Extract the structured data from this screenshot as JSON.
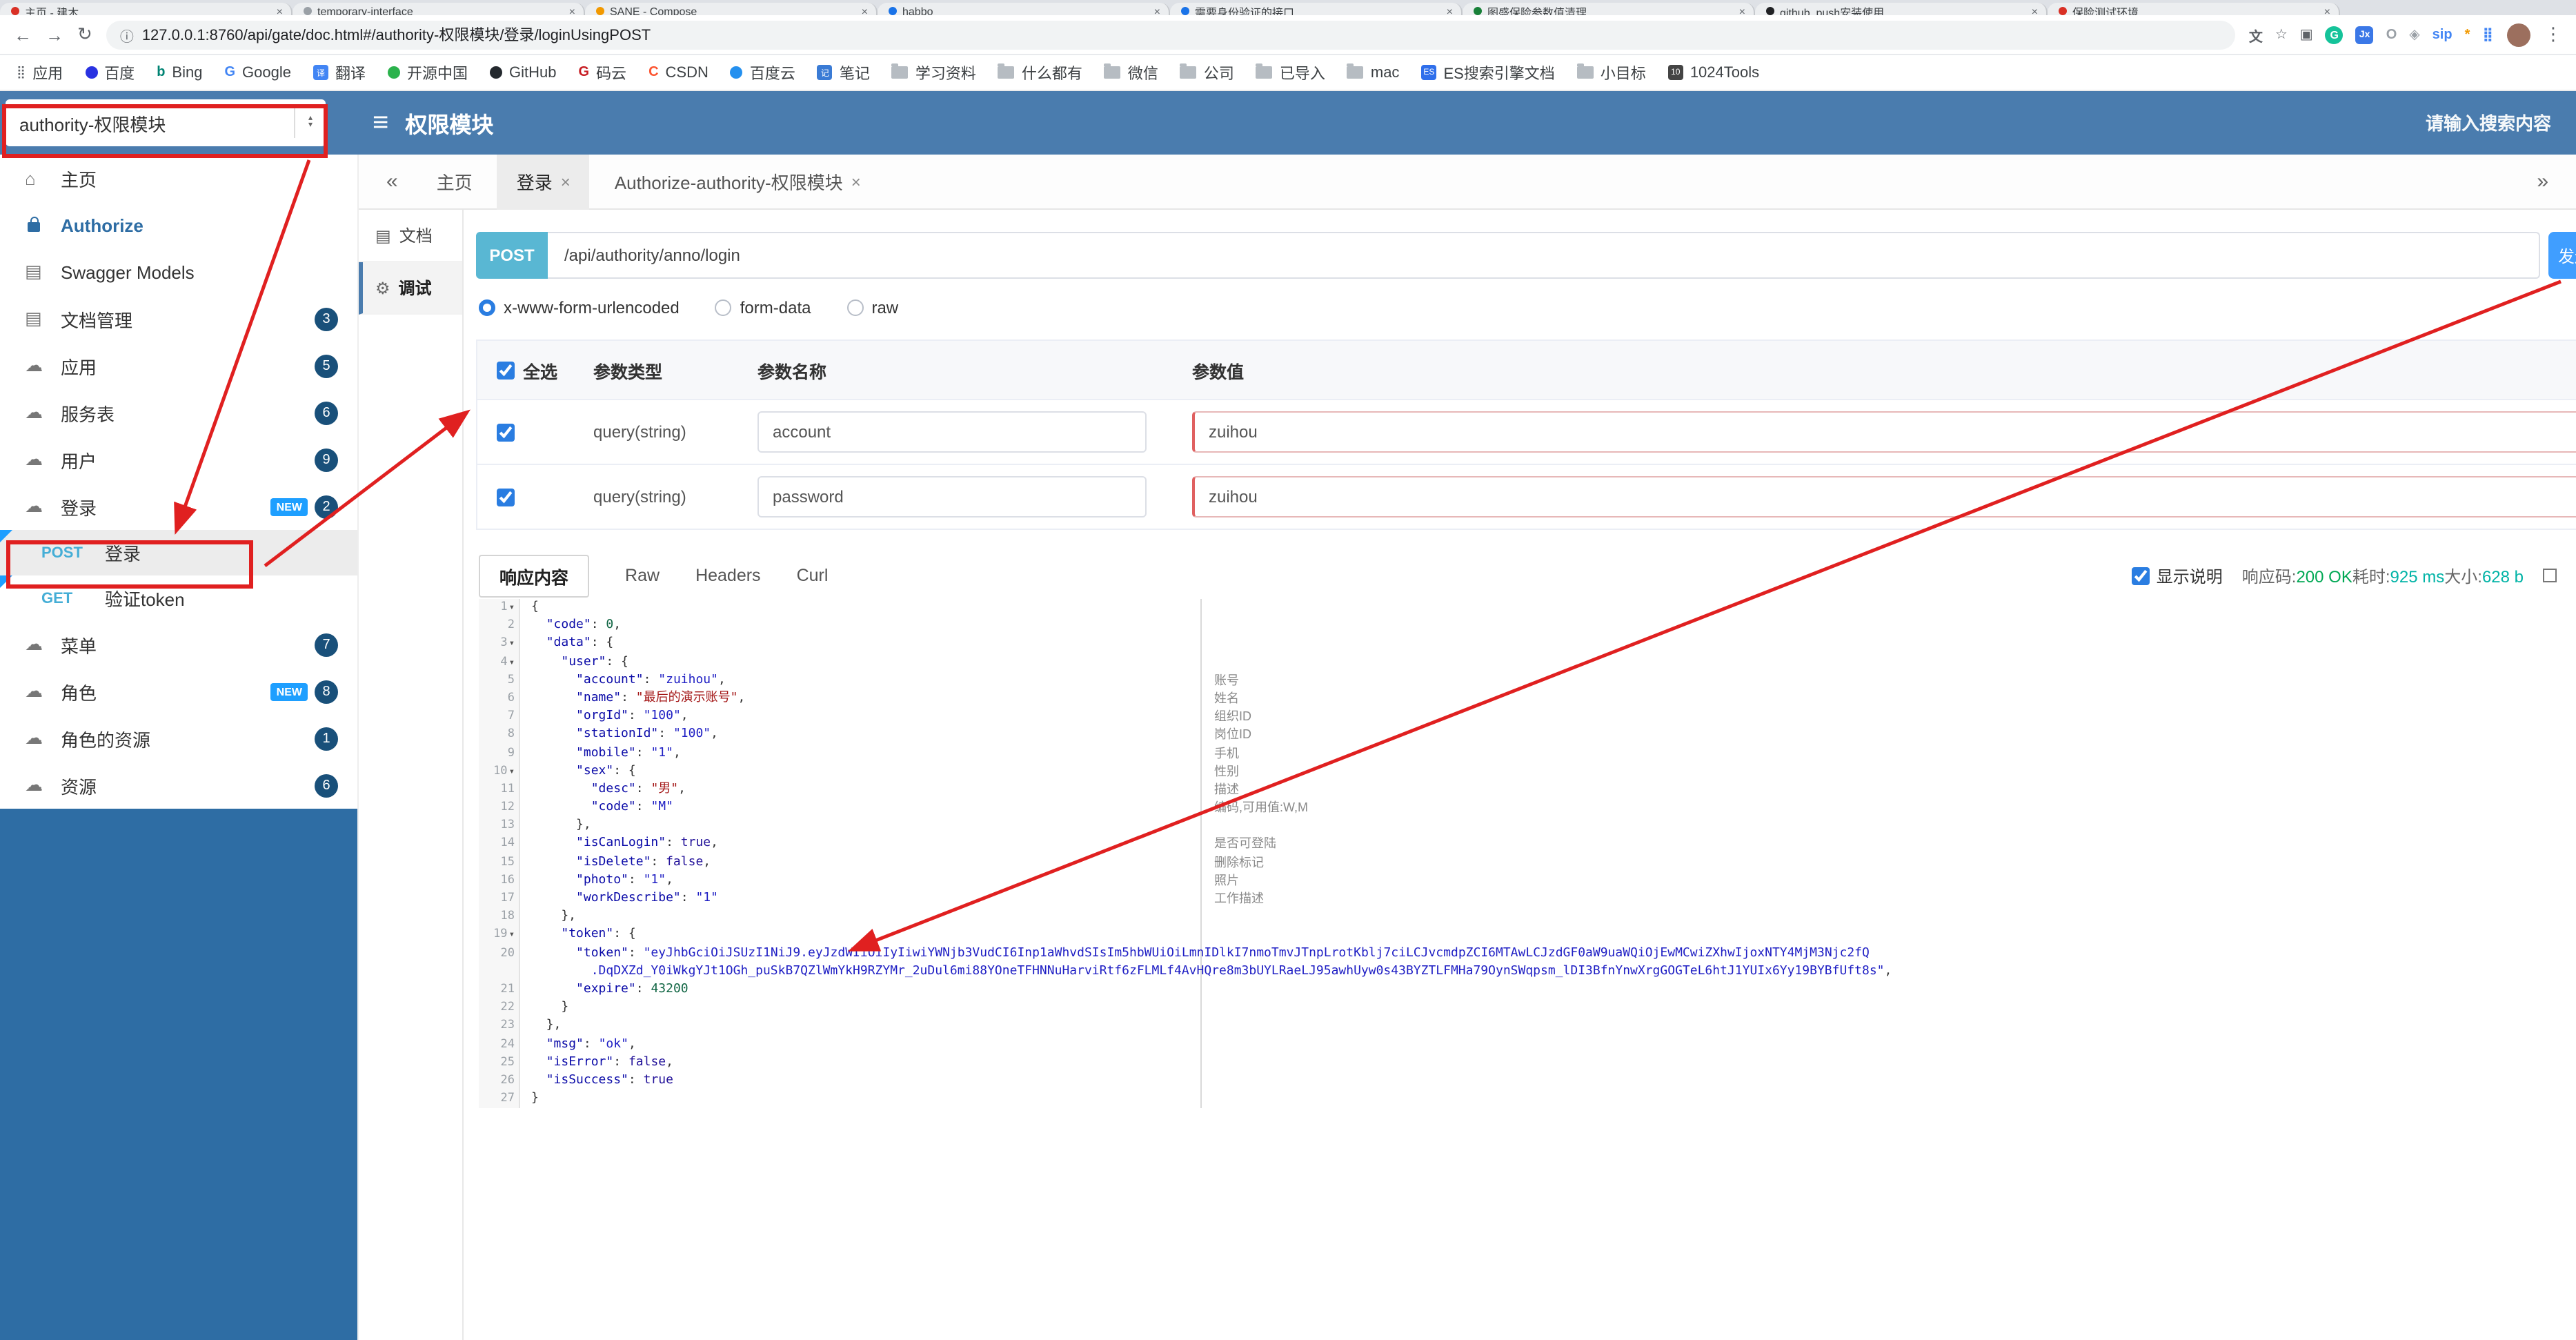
{
  "colors": {
    "header_blue": "#4a7cae",
    "sidebar_blue": "#2e6da4",
    "accent_blue": "#409eff",
    "post_badge_blue": "#59b7d3",
    "badge_navy": "#19507a",
    "new_badge_blue": "#1e9fff",
    "annotation_red": "#e02020",
    "success_green": "#00a854",
    "teal": "#00b3a6"
  },
  "icons": {
    "hamburger": "≡",
    "home": "⌂",
    "models": "▤",
    "docfolder": "▤",
    "cloud": "☁",
    "doc": "▤",
    "debug": "⚙",
    "collapse": "«",
    "expand": "»",
    "back": "←",
    "forward": "→",
    "reload": "↻",
    "info": "ⓘ",
    "more": "⋮",
    "sort_up": "▴",
    "sort_down": "▾",
    "close": "×",
    "grid": "⣿"
  },
  "browser": {
    "close_glyph": "×",
    "url": "127.0.0.1:8760/api/gate/doc.html#/authority-权限模块/登录/loginUsingPOST",
    "tabs": [
      {
        "label": "主页 - 建木",
        "color": "#d93025"
      },
      {
        "label": "temporary-interface",
        "color": "#9aa0a6"
      },
      {
        "label": "SANE - Compose",
        "color": "#f29900"
      },
      {
        "label": "habbo",
        "color": "#1a73e8"
      },
      {
        "label": "需要身份验证的接口",
        "color": "#1a73e8"
      },
      {
        "label": "图盛保险参数值清理",
        "color": "#188038"
      },
      {
        "label": "github_push安装使用",
        "color": "#202124"
      },
      {
        "label": "保险测试环境",
        "color": "#d93025"
      }
    ],
    "bookmarks": [
      {
        "label": "应用",
        "icon": "grid"
      },
      {
        "label": "百度",
        "icon": "dot",
        "color": "#2932e1"
      },
      {
        "label": "Bing",
        "icon": "letter",
        "glyph": "b",
        "color": "#008373"
      },
      {
        "label": "Google",
        "icon": "letter",
        "glyph": "G",
        "color": "#4285f4"
      },
      {
        "label": "翻译",
        "icon": "square",
        "glyph": "译",
        "color": "#4285f4"
      },
      {
        "label": "开源中国",
        "icon": "dot",
        "color": "#2bb24c"
      },
      {
        "label": "GitHub",
        "icon": "dot",
        "color": "#24292e"
      },
      {
        "label": "码云",
        "icon": "letter",
        "glyph": "G",
        "color": "#c71d23"
      },
      {
        "label": "CSDN",
        "icon": "letter",
        "glyph": "C",
        "color": "#fc5531"
      },
      {
        "label": "百度云",
        "icon": "dot",
        "color": "#2490ef"
      },
      {
        "label": "笔记",
        "icon": "square",
        "glyph": "记",
        "color": "#3a7bd5"
      },
      {
        "label": "学习资料",
        "icon": "folder"
      },
      {
        "label": "什么都有",
        "icon": "folder"
      },
      {
        "label": "微信",
        "icon": "folder"
      },
      {
        "label": "公司",
        "icon": "folder"
      },
      {
        "label": "已导入",
        "icon": "folder"
      },
      {
        "label": "mac",
        "icon": "folder"
      },
      {
        "label": "ES搜索引擎文档",
        "icon": "square",
        "glyph": "ES",
        "color": "#2f6feb"
      },
      {
        "label": "小目标",
        "icon": "folder"
      },
      {
        "label": "1024Tools",
        "icon": "square",
        "glyph": "10",
        "color": "#444444"
      }
    ],
    "ext_icons": [
      {
        "name": "translate-icon",
        "glyph": "文",
        "color": "#5f6368",
        "shape": "plain"
      },
      {
        "name": "bookmark-star-icon",
        "glyph": "☆",
        "color": "#5f6368",
        "shape": "plain"
      },
      {
        "name": "screenshot-ext-icon",
        "glyph": "▣",
        "color": "#5f6368",
        "shape": "plain"
      },
      {
        "name": "grammarly-ext-icon",
        "glyph": "G",
        "color": "#15c39a",
        "shape": "circle"
      },
      {
        "name": "json-ext-icon",
        "glyph": "Jx",
        "color": "#3b78e7",
        "shape": "square"
      },
      {
        "name": "ring-ext-icon",
        "glyph": "O",
        "color": "#9aa0a6",
        "shape": "plain"
      },
      {
        "name": "shield-ext-icon",
        "glyph": "◈",
        "color": "#9aa0a6",
        "shape": "plain"
      },
      {
        "name": "sip-ext-icon",
        "glyph": "sip",
        "color": "#4285f4",
        "shape": "plain"
      },
      {
        "name": "pinwheel-ext-icon",
        "glyph": "*",
        "color": "#f29900",
        "shape": "plain"
      },
      {
        "name": "grid-ext-icon",
        "glyph": "⣿",
        "color": "#4285f4",
        "shape": "plain"
      }
    ]
  },
  "header": {
    "module_select": "authority-权限模块",
    "title": "权限模块",
    "search_placeholder": "请输入搜索内容"
  },
  "sidebar": {
    "new_badge": "NEW",
    "items": [
      {
        "label": "主页"
      },
      {
        "label": "Authorize"
      },
      {
        "label": "Swagger Models"
      },
      {
        "label": "文档管理",
        "badge": "3"
      },
      {
        "label": "应用",
        "badge": "5"
      },
      {
        "label": "服务表",
        "badge": "6"
      },
      {
        "label": "用户",
        "badge": "9"
      },
      {
        "label": "登录",
        "badge": "2",
        "tag": "NEW"
      },
      {
        "label": "菜单",
        "badge": "7"
      },
      {
        "label": "角色",
        "badge": "8",
        "tag": "NEW"
      },
      {
        "label": "角色的资源",
        "badge": "1"
      },
      {
        "label": "资源",
        "badge": "6"
      }
    ],
    "operations": [
      {
        "method": "POST",
        "label": "登录"
      },
      {
        "method": "GET",
        "label": "验证token"
      }
    ]
  },
  "tabsbar": {
    "tabs": [
      {
        "label": "主页"
      },
      {
        "label": "登录"
      },
      {
        "label": "Authorize-authority-权限模块"
      }
    ]
  },
  "docmenu": {
    "doc": "文档",
    "debug": "调试"
  },
  "request": {
    "method": "POST",
    "url": "/api/authority/anno/login",
    "send_label": "发送",
    "content_types": [
      "x-www-form-urlencoded",
      "form-data",
      "raw"
    ],
    "selected_content_type": "x-www-form-urlencoded",
    "table": {
      "select_all": "全选",
      "headers": [
        "参数类型",
        "参数名称",
        "参数值"
      ],
      "rows": [
        {
          "type": "query(string)",
          "name": "account",
          "value": "zuihou"
        },
        {
          "type": "query(string)",
          "name": "password",
          "value": "zuihou"
        }
      ]
    }
  },
  "response": {
    "tabs": [
      "响应内容",
      "Raw",
      "Headers",
      "Curl"
    ],
    "active_tab": "响应内容",
    "show_desc_label": "显示说明",
    "meta": {
      "code_label": "响应码:",
      "code": "200 OK",
      "time_label": "耗时:",
      "time": "925 ms",
      "size_label": "大小:",
      "size": "628 b"
    }
  },
  "code": {
    "rows": [
      {
        "n": "1",
        "fold": true,
        "segs": [
          [
            "p",
            "{"
          ]
        ]
      },
      {
        "n": "2",
        "segs": [
          [
            "p",
            "  "
          ],
          [
            "k",
            "\"code\""
          ],
          [
            "p",
            ": "
          ],
          [
            "num",
            "0"
          ],
          [
            "p",
            ","
          ]
        ]
      },
      {
        "n": "3",
        "fold": true,
        "segs": [
          [
            "p",
            "  "
          ],
          [
            "k",
            "\"data\""
          ],
          [
            "p",
            ": {"
          ]
        ]
      },
      {
        "n": "4",
        "fold": true,
        "segs": [
          [
            "p",
            "    "
          ],
          [
            "k",
            "\"user\""
          ],
          [
            "p",
            ": {"
          ]
        ]
      },
      {
        "n": "5",
        "segs": [
          [
            "p",
            "      "
          ],
          [
            "k",
            "\"account\""
          ],
          [
            "p",
            ": "
          ],
          [
            "s",
            "\"zuihou\""
          ],
          [
            "p",
            ","
          ]
        ],
        "desc": "账号"
      },
      {
        "n": "6",
        "segs": [
          [
            "p",
            "      "
          ],
          [
            "k",
            "\"name\""
          ],
          [
            "p",
            ": "
          ],
          [
            "cn",
            "\"最后的演示账号\""
          ],
          [
            "p",
            ","
          ]
        ],
        "desc": "姓名"
      },
      {
        "n": "7",
        "segs": [
          [
            "p",
            "      "
          ],
          [
            "k",
            "\"orgId\""
          ],
          [
            "p",
            ": "
          ],
          [
            "s",
            "\"100\""
          ],
          [
            "p",
            ","
          ]
        ],
        "desc": "组织ID"
      },
      {
        "n": "8",
        "segs": [
          [
            "p",
            "      "
          ],
          [
            "k",
            "\"stationId\""
          ],
          [
            "p",
            ": "
          ],
          [
            "s",
            "\"100\""
          ],
          [
            "p",
            ","
          ]
        ],
        "desc": "岗位ID"
      },
      {
        "n": "9",
        "segs": [
          [
            "p",
            "      "
          ],
          [
            "k",
            "\"mobile\""
          ],
          [
            "p",
            ": "
          ],
          [
            "s",
            "\"1\""
          ],
          [
            "p",
            ","
          ]
        ],
        "desc": "手机"
      },
      {
        "n": "10",
        "fold": true,
        "segs": [
          [
            "p",
            "      "
          ],
          [
            "k",
            "\"sex\""
          ],
          [
            "p",
            ": {"
          ]
        ],
        "desc": "性别"
      },
      {
        "n": "11",
        "segs": [
          [
            "p",
            "        "
          ],
          [
            "k",
            "\"desc\""
          ],
          [
            "p",
            ": "
          ],
          [
            "cn",
            "\"男\""
          ],
          [
            "p",
            ","
          ]
        ],
        "desc": "描述"
      },
      {
        "n": "12",
        "segs": [
          [
            "p",
            "        "
          ],
          [
            "k",
            "\"code\""
          ],
          [
            "p",
            ": "
          ],
          [
            "s",
            "\"M\""
          ]
        ],
        "desc": "编码,可用值:W,M"
      },
      {
        "n": "13",
        "segs": [
          [
            "p",
            "      },"
          ]
        ]
      },
      {
        "n": "14",
        "segs": [
          [
            "p",
            "      "
          ],
          [
            "k",
            "\"isCanLogin\""
          ],
          [
            "p",
            ": "
          ],
          [
            "b",
            "true"
          ],
          [
            "p",
            ","
          ]
        ],
        "desc": "是否可登陆"
      },
      {
        "n": "15",
        "segs": [
          [
            "p",
            "      "
          ],
          [
            "k",
            "\"isDelete\""
          ],
          [
            "p",
            ": "
          ],
          [
            "b",
            "false"
          ],
          [
            "p",
            ","
          ]
        ],
        "desc": "删除标记"
      },
      {
        "n": "16",
        "segs": [
          [
            "p",
            "      "
          ],
          [
            "k",
            "\"photo\""
          ],
          [
            "p",
            ": "
          ],
          [
            "s",
            "\"1\""
          ],
          [
            "p",
            ","
          ]
        ],
        "desc": "照片"
      },
      {
        "n": "17",
        "segs": [
          [
            "p",
            "      "
          ],
          [
            "k",
            "\"workDescribe\""
          ],
          [
            "p",
            ": "
          ],
          [
            "s",
            "\"1\""
          ]
        ],
        "desc": "工作描述"
      },
      {
        "n": "18",
        "segs": [
          [
            "p",
            "    },"
          ]
        ]
      },
      {
        "n": "19",
        "fold": true,
        "segs": [
          [
            "p",
            "    "
          ],
          [
            "k",
            "\"token\""
          ],
          [
            "p",
            ": {"
          ]
        ]
      },
      {
        "n": "20",
        "segs": [
          [
            "p",
            "      "
          ],
          [
            "k",
            "\"token\""
          ],
          [
            "p",
            ": "
          ],
          [
            "s",
            "\"eyJhbGciOiJSUzI1NiJ9.eyJzdWIiOiIyIiwiYWNjb3VudCI6Inp1aWhvdSIsIm5hbWUiOiLmnIDlkI7nmoTmvJTnpLrotKblj7ciLCJvcmdpZCI6MTAwLCJzdGF0aW9uaWQiOjEwMCwiZXhwIjoxNTY4MjM3Njc2fQ"
          ]
        ]
      },
      {
        "n": "",
        "segs": [
          [
            "p",
            "        "
          ],
          [
            "s",
            ".DqDXZd_Y0iWkgYJt1OGh_puSkB7QZlWmYkH9RZYMr_2uDul6mi88YOneTFHNNuHarviRtf6zFLMLf4AvHQre8m3bUYLRaeLJ95awhUyw0s43BYZTLFMHa79OynSWqpsm_lDI3BfnYnwXrgGOGTeL6htJ1YUIx6Yy19BYBfUft8s\""
          ],
          [
            "p",
            ","
          ]
        ]
      },
      {
        "n": "21",
        "segs": [
          [
            "p",
            "      "
          ],
          [
            "k",
            "\"expire\""
          ],
          [
            "p",
            ": "
          ],
          [
            "num",
            "43200"
          ]
        ]
      },
      {
        "n": "22",
        "segs": [
          [
            "p",
            "    }"
          ]
        ]
      },
      {
        "n": "23",
        "segs": [
          [
            "p",
            "  },"
          ]
        ]
      },
      {
        "n": "24",
        "segs": [
          [
            "p",
            "  "
          ],
          [
            "k",
            "\"msg\""
          ],
          [
            "p",
            ": "
          ],
          [
            "s",
            "\"ok\""
          ],
          [
            "p",
            ","
          ]
        ]
      },
      {
        "n": "25",
        "segs": [
          [
            "p",
            "  "
          ],
          [
            "k",
            "\"isError\""
          ],
          [
            "p",
            ": "
          ],
          [
            "b",
            "false"
          ],
          [
            "p",
            ","
          ]
        ]
      },
      {
        "n": "26",
        "segs": [
          [
            "p",
            "  "
          ],
          [
            "k",
            "\"isSuccess\""
          ],
          [
            "p",
            ": "
          ],
          [
            "b",
            "true"
          ]
        ]
      },
      {
        "n": "27",
        "segs": [
          [
            "p",
            "}"
          ]
        ]
      }
    ]
  }
}
